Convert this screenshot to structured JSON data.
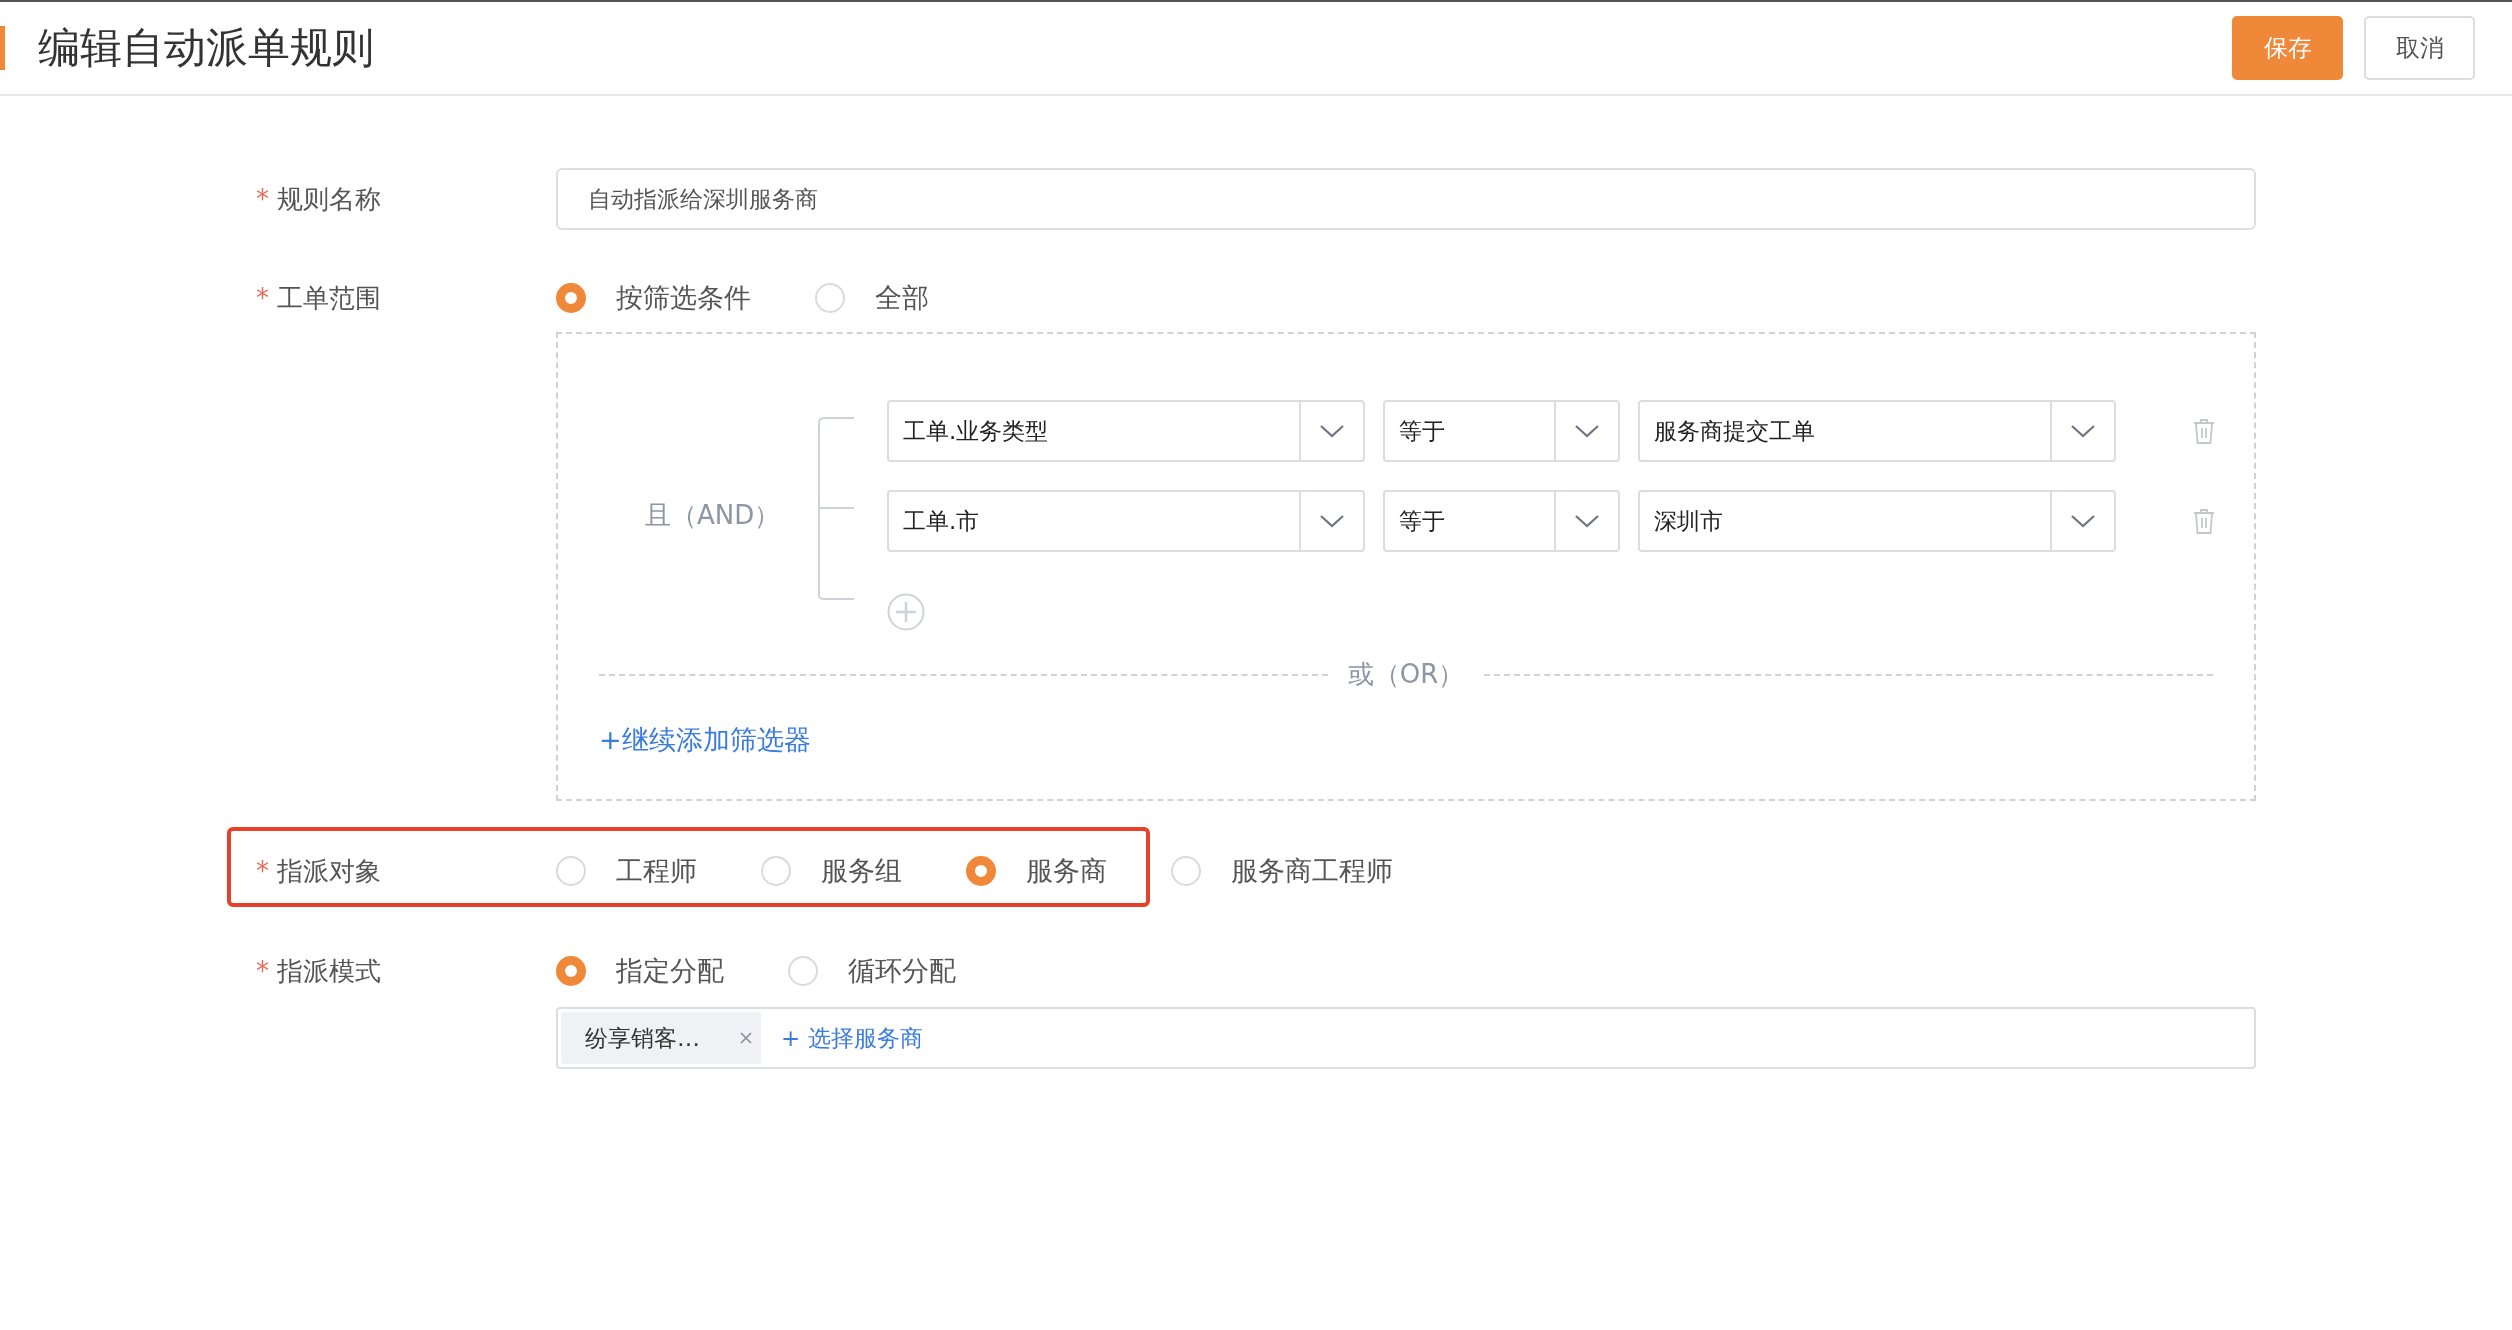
{
  "header": {
    "title": "编辑自动派单规则",
    "buttons": [
      {
        "label": "保存",
        "kind": "primary"
      },
      {
        "label": "取消",
        "kind": "default"
      }
    ]
  },
  "rule_name": {
    "label": "规则名称",
    "required_mark": "*",
    "value": "自动指派给深圳服务商"
  },
  "order_scope": {
    "label": "工单范围",
    "required_mark": "*",
    "options": [
      {
        "label": "按筛选条件",
        "selected": true
      },
      {
        "label": "全部",
        "selected": false
      }
    ]
  },
  "filter": {
    "logic_label": "且（AND）",
    "conditions": [
      {
        "field": "工单.业务类型",
        "operator": "等于",
        "value": "服务商提交工单"
      },
      {
        "field": "工单.市",
        "operator": "等于",
        "value": "深圳市"
      }
    ],
    "or_label": "或（OR）",
    "add_filter_link": "+继续添加筛选器"
  },
  "assign_target": {
    "label": "指派对象",
    "required_mark": "*",
    "highlighted": true,
    "options": [
      {
        "label": "工程师",
        "selected": false
      },
      {
        "label": "服务组",
        "selected": false
      },
      {
        "label": "服务商",
        "selected": true
      },
      {
        "label": "服务商工程师",
        "selected": false
      }
    ]
  },
  "assign_mode": {
    "label": "指派模式",
    "required_mark": "*",
    "options": [
      {
        "label": "指定分配",
        "selected": true
      },
      {
        "label": "循环分配",
        "selected": false
      }
    ],
    "tags": [
      {
        "label": "纷享销客…"
      }
    ],
    "add_link": "+ 选择服务商"
  }
}
